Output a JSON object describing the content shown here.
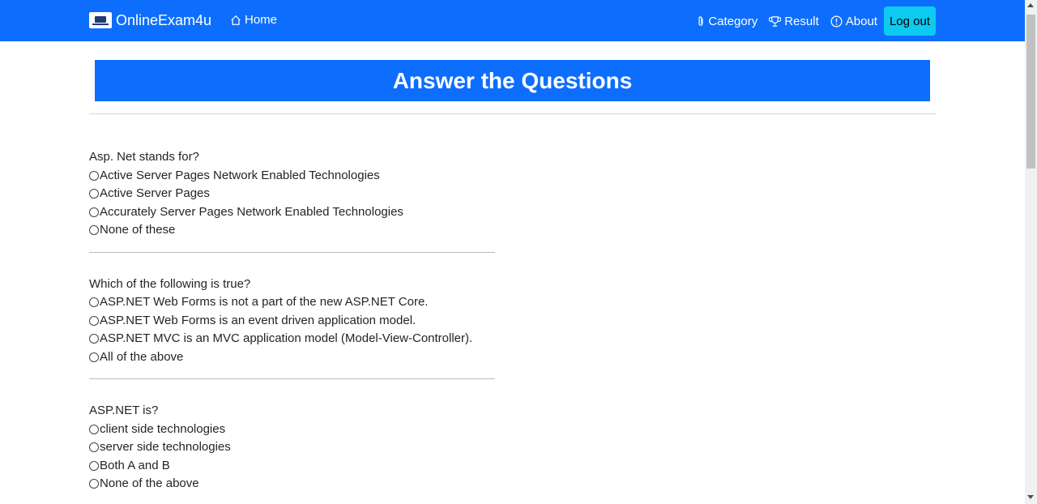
{
  "navbar": {
    "brand": "OnlineExam4u",
    "home": "Home",
    "category": "Category",
    "result": "Result",
    "about": "About",
    "logout": "Log out",
    "color": "#0d6efd",
    "logout_color": "#0dcaf0"
  },
  "page": {
    "heading": "Answer the Questions"
  },
  "questions": [
    {
      "text": "Asp. Net stands for?",
      "options": [
        "Active Server Pages Network Enabled Technologies",
        "Active Server Pages",
        "Accurately Server Pages Network Enabled Technologies",
        "None of these"
      ]
    },
    {
      "text": "Which of the following is true?",
      "options": [
        "ASP.NET Web Forms is not a part of the new ASP.NET Core.",
        "ASP.NET Web Forms is an event driven application model.",
        "ASP.NET MVC is an MVC application model (Model-View-Controller).",
        "All of the above"
      ]
    },
    {
      "text": "ASP.NET is?",
      "options": [
        "client side technologies",
        "server side technologies",
        "Both A and B",
        "None of the above"
      ]
    }
  ]
}
